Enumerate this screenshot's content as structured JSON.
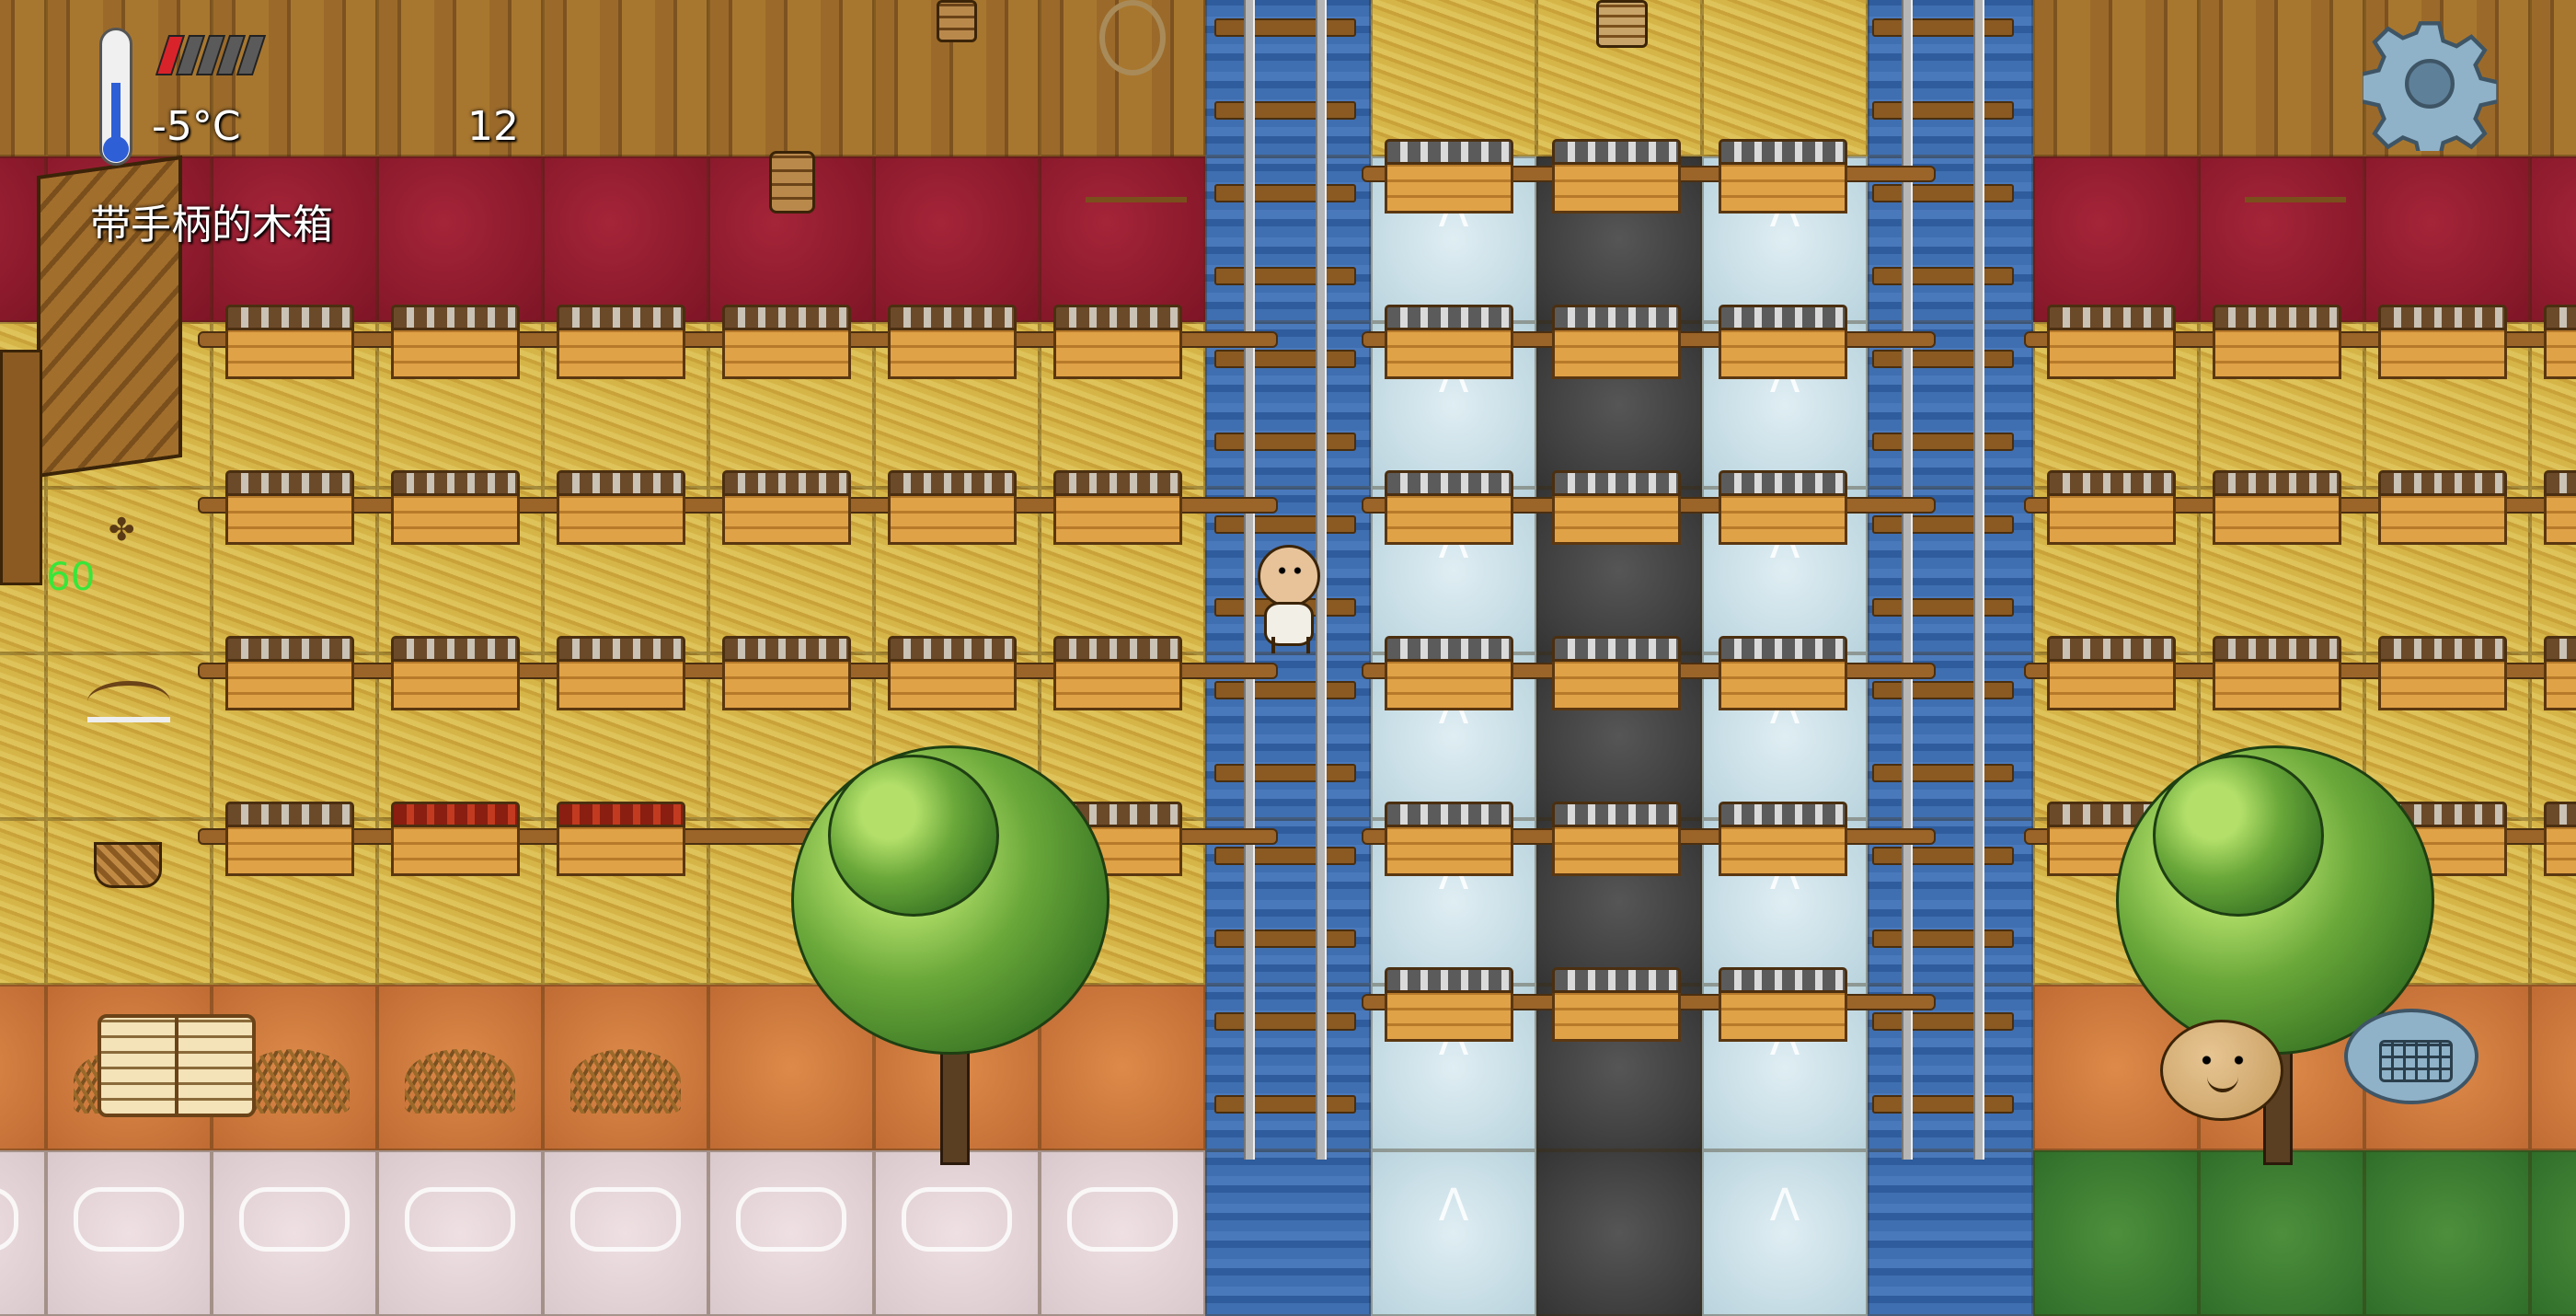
{
  "hud": {
    "temperature": "-5°C",
    "counter": "12",
    "held_item": "带手柄的木箱",
    "fps": "60",
    "health_segments_total": 5,
    "health_segments_filled": 1
  },
  "colors": {
    "health_filled": "#d9232b",
    "health_empty": "#5a5a5a",
    "fps_text": "#39e639",
    "thermometer_bulb": "#2f5fd6"
  },
  "icons": {
    "settings": "gear-icon",
    "recipe_book": "open-book-icon",
    "emote": "character-face-icon",
    "chat": "keyboard-icon",
    "temperature": "thermometer-icon"
  }
}
